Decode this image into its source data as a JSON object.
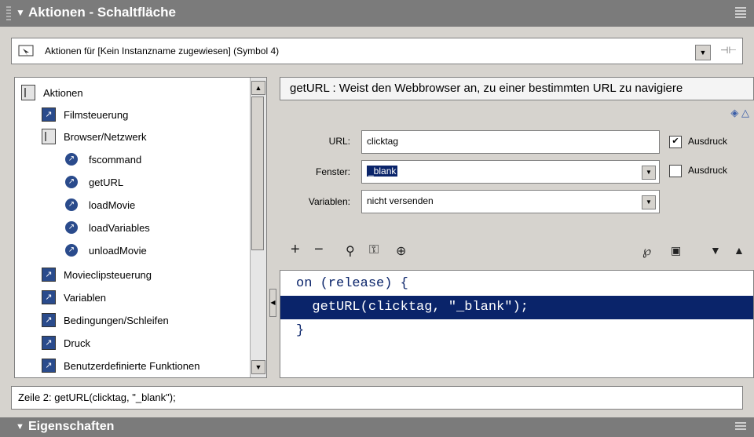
{
  "panel": {
    "title": "Aktionen - Schaltfläche"
  },
  "target": {
    "label": "Aktionen für [Kein Instanzname zugewiesen] (Symbol 4)"
  },
  "tree": {
    "root": "Aktionen",
    "filmsteuerung": "Filmsteuerung",
    "browser": "Browser/Netzwerk",
    "fscommand": "fscommand",
    "getURL": "getURL",
    "loadMovie": "loadMovie",
    "loadVariables": "loadVariables",
    "unloadMovie": "unloadMovie",
    "movieclip": "Movieclipsteuerung",
    "variablen": "Variablen",
    "bedingungen": "Bedingungen/Schleifen",
    "druck": "Druck",
    "funktionen": "Benutzerdefinierte Funktionen"
  },
  "description": "getURL : Weist den Webbrowser an, zu einer bestimmten URL zu navigiere",
  "params": {
    "url_label": "URL:",
    "url_value": "clicktag",
    "fenster_label": "Fenster:",
    "fenster_value": "_blank",
    "variablen_label": "Variablen:",
    "variablen_value": "nicht versenden",
    "ausdruck1": "Ausdruck",
    "ausdruck2": "Ausdruck",
    "ausdruck1_checked": true,
    "ausdruck2_checked": false
  },
  "code": {
    "line1": "on (release) {",
    "line2": "  getURL(clicktag, \"_blank\");",
    "line3": "}"
  },
  "status": "Zeile 2: getURL(clicktag, \"_blank\");",
  "bottom": {
    "title": "Eigenschaften"
  }
}
